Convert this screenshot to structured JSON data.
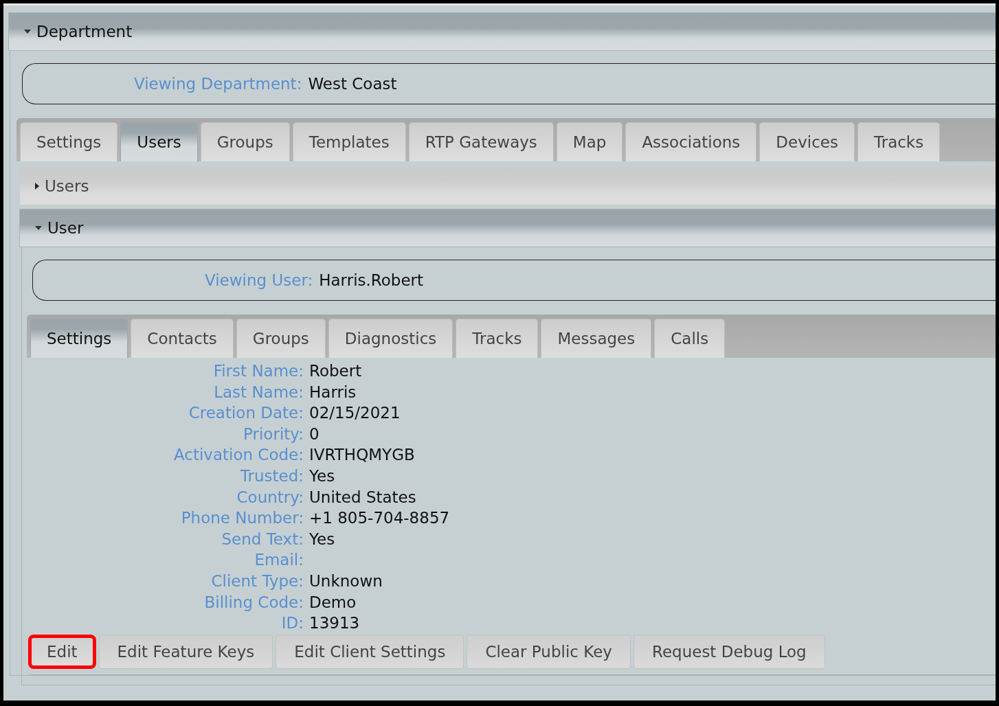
{
  "department_section": {
    "title": "Department",
    "expanded": true,
    "viewing_label": "Viewing Department:",
    "viewing_value": "West Coast"
  },
  "department_tabs": [
    {
      "label": "Settings",
      "selected": false
    },
    {
      "label": "Users",
      "selected": true
    },
    {
      "label": "Groups",
      "selected": false
    },
    {
      "label": "Templates",
      "selected": false
    },
    {
      "label": "RTP Gateways",
      "selected": false
    },
    {
      "label": "Map",
      "selected": false
    },
    {
      "label": "Associations",
      "selected": false
    },
    {
      "label": "Devices",
      "selected": false
    },
    {
      "label": "Tracks",
      "selected": false
    }
  ],
  "users_section": {
    "title": "Users",
    "expanded": false
  },
  "user_section": {
    "title": "User",
    "expanded": true,
    "viewing_label": "Viewing User:",
    "viewing_value": "Harris.Robert"
  },
  "user_tabs": [
    {
      "label": "Settings",
      "selected": true
    },
    {
      "label": "Contacts",
      "selected": false
    },
    {
      "label": "Groups",
      "selected": false
    },
    {
      "label": "Diagnostics",
      "selected": false
    },
    {
      "label": "Tracks",
      "selected": false
    },
    {
      "label": "Messages",
      "selected": false
    },
    {
      "label": "Calls",
      "selected": false
    }
  ],
  "fields": [
    {
      "label": "First Name:",
      "value": "Robert"
    },
    {
      "label": "Last Name:",
      "value": "Harris"
    },
    {
      "label": "Creation Date:",
      "value": "02/15/2021"
    },
    {
      "label": "Priority:",
      "value": "0"
    },
    {
      "label": "Activation Code:",
      "value": "IVRTHQMYGB"
    },
    {
      "label": "Trusted:",
      "value": "Yes"
    },
    {
      "label": "Country:",
      "value": "United States"
    },
    {
      "label": "Phone Number:",
      "value": "+1 805-704-8857"
    },
    {
      "label": "Send Text:",
      "value": "Yes"
    },
    {
      "label": "Email:"
    },
    {
      "label": "Client Type:",
      "value": "Unknown"
    },
    {
      "label": "Billing Code:",
      "value": "Demo"
    },
    {
      "label": "ID:",
      "value": "13913"
    }
  ],
  "buttons": [
    {
      "label": "Edit",
      "highlighted": true
    },
    {
      "label": "Edit Feature Keys",
      "highlighted": false
    },
    {
      "label": "Edit Client Settings",
      "highlighted": false
    },
    {
      "label": "Clear Public Key",
      "highlighted": false
    },
    {
      "label": "Request Debug Log",
      "highlighted": false
    }
  ]
}
